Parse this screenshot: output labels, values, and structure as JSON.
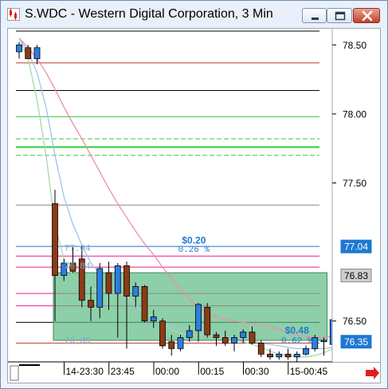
{
  "window": {
    "title": "S.WDC - Western Digital Corporation, 3 Min",
    "icon": "chart-app-icon",
    "buttons": [
      "minimize-icon",
      "maximize-icon",
      "close-icon"
    ]
  },
  "chart_data": {
    "type": "candlestick",
    "symbol": "S.WDC",
    "interval": "3 Min",
    "y_range": [
      76.25,
      78.6
    ],
    "y_ticks": [
      "78.50",
      "78.00",
      "77.50",
      "77.04",
      "76.83",
      "76.50",
      "76.35"
    ],
    "y_tick_values": [
      78.5,
      78.0,
      77.5,
      77.04,
      76.83,
      76.5,
      76.35
    ],
    "price_badges": [
      {
        "label": "77.04",
        "value": 77.04,
        "color": "#1e78d2"
      },
      {
        "label": "76.83",
        "value": 76.83,
        "color": "#cfcfcf"
      },
      {
        "label": "76.35",
        "value": 76.35,
        "color": "#1e78d2"
      }
    ],
    "x_ticks": [
      "14-23:30",
      "23:45",
      "00:00",
      "00:15",
      "00:30",
      "15-00:45"
    ],
    "x_tick_bar_index": [
      6,
      11,
      16,
      21,
      26,
      31
    ],
    "candles": [
      {
        "o": 78.45,
        "h": 78.52,
        "l": 78.4,
        "c": 78.5
      },
      {
        "o": 78.48,
        "h": 78.5,
        "l": 78.4,
        "c": 78.4
      },
      {
        "o": 78.4,
        "h": 78.5,
        "l": 78.36,
        "c": 78.48
      },
      null,
      {
        "o": 77.35,
        "h": 77.45,
        "l": 76.5,
        "c": 76.83
      },
      {
        "o": 76.83,
        "h": 76.95,
        "l": 76.79,
        "c": 76.92
      },
      {
        "o": 76.92,
        "h": 77.04,
        "l": 76.85,
        "c": 76.86
      },
      {
        "o": 76.95,
        "h": 77.04,
        "l": 76.6,
        "c": 76.65
      },
      {
        "o": 76.65,
        "h": 76.75,
        "l": 76.5,
        "c": 76.6
      },
      {
        "o": 76.6,
        "h": 76.92,
        "l": 76.52,
        "c": 76.88
      },
      {
        "o": 76.85,
        "h": 76.93,
        "l": 76.58,
        "c": 76.7
      },
      {
        "o": 76.7,
        "h": 76.92,
        "l": 76.38,
        "c": 76.9
      },
      {
        "o": 76.9,
        "h": 76.93,
        "l": 76.3,
        "c": 76.68
      },
      {
        "o": 76.68,
        "h": 76.78,
        "l": 76.6,
        "c": 76.75
      },
      {
        "o": 76.75,
        "h": 76.76,
        "l": 76.49,
        "c": 76.5
      },
      {
        "o": 76.5,
        "h": 76.58,
        "l": 76.45,
        "c": 76.53
      },
      {
        "o": 76.5,
        "h": 76.52,
        "l": 76.3,
        "c": 76.32
      },
      {
        "o": 76.35,
        "h": 76.4,
        "l": 76.25,
        "c": 76.3
      },
      {
        "o": 76.3,
        "h": 76.4,
        "l": 76.28,
        "c": 76.38
      },
      {
        "o": 76.38,
        "h": 76.47,
        "l": 76.35,
        "c": 76.43
      },
      {
        "o": 76.43,
        "h": 76.63,
        "l": 76.35,
        "c": 76.62
      },
      {
        "o": 76.6,
        "h": 76.63,
        "l": 76.38,
        "c": 76.4
      },
      {
        "o": 76.4,
        "h": 76.42,
        "l": 76.32,
        "c": 76.38
      },
      {
        "o": 76.38,
        "h": 76.43,
        "l": 76.32,
        "c": 76.34
      },
      {
        "o": 76.34,
        "h": 76.4,
        "l": 76.28,
        "c": 76.38
      },
      {
        "o": 76.38,
        "h": 76.44,
        "l": 76.34,
        "c": 76.42
      },
      {
        "o": 76.42,
        "h": 76.46,
        "l": 76.33,
        "c": 76.34
      },
      {
        "o": 76.34,
        "h": 76.36,
        "l": 76.24,
        "c": 76.26
      },
      {
        "o": 76.26,
        "h": 76.3,
        "l": 76.22,
        "c": 76.24
      },
      {
        "o": 76.24,
        "h": 76.28,
        "l": 76.22,
        "c": 76.26
      },
      {
        "o": 76.26,
        "h": 76.3,
        "l": 76.22,
        "c": 76.24
      },
      {
        "o": 76.24,
        "h": 76.28,
        "l": 76.2,
        "c": 76.26
      },
      {
        "o": 76.26,
        "h": 76.32,
        "l": 76.25,
        "c": 76.3
      },
      {
        "o": 76.3,
        "h": 76.4,
        "l": 76.28,
        "c": 76.38
      },
      {
        "o": 76.35,
        "h": 76.38,
        "l": 76.25,
        "c": 76.36
      },
      {
        "o": 76.33,
        "h": 76.53,
        "l": 76.3,
        "c": 76.51
      },
      {
        "o": 76.5,
        "h": 76.56,
        "l": 76.48,
        "c": 76.51
      }
    ],
    "horizontal_levels": [
      {
        "value": 78.6,
        "color": "#000000",
        "style": "solid",
        "width": 1
      },
      {
        "value": 78.37,
        "color": "#c0392b",
        "style": "solid",
        "width": 1
      },
      {
        "value": 78.17,
        "color": "#000000",
        "style": "solid",
        "width": 1
      },
      {
        "value": 77.98,
        "color": "#2ecc40",
        "style": "solid",
        "width": 1
      },
      {
        "value": 77.82,
        "color": "#2ecc40",
        "style": "dashed",
        "width": 1
      },
      {
        "value": 77.76,
        "color": "#2ecc40",
        "style": "solid",
        "width": 2
      },
      {
        "value": 77.7,
        "color": "#2ecc40",
        "style": "dashed",
        "width": 1
      },
      {
        "value": 77.34,
        "color": "#888888",
        "style": "solid",
        "width": 1
      },
      {
        "value": 77.04,
        "color": "#1e78d2",
        "style": "solid",
        "width": 1
      },
      {
        "value": 76.97,
        "color": "#e91e8c",
        "style": "solid",
        "width": 1
      },
      {
        "value": 76.89,
        "color": "#e91e8c",
        "style": "solid",
        "width": 1
      },
      {
        "value": 76.7,
        "color": "#e91e8c",
        "style": "solid",
        "width": 1
      },
      {
        "value": 76.61,
        "color": "#e91e8c",
        "style": "solid",
        "width": 1
      },
      {
        "value": 76.49,
        "color": "#000000",
        "style": "solid",
        "width": 1
      },
      {
        "value": 76.34,
        "color": "#c0392b",
        "style": "solid",
        "width": 1
      }
    ],
    "range_box": {
      "from_index": 4,
      "to_index": 34,
      "high": 76.85,
      "low": 76.36,
      "color": "#5dbb83"
    },
    "annotations": [
      {
        "text": "$0.20",
        "value": 77.06,
        "bar": 19.5,
        "color": "#1e78d2",
        "bold": true
      },
      {
        "text": "0.26 %",
        "value": 77.0,
        "bar": 19.5,
        "color": "#1e78d2",
        "bold": false
      },
      {
        "text": "77.04",
        "value": 77.01,
        "bar": 6.5,
        "color": "#7fa6cf",
        "bold": false
      },
      {
        "text": "76.84",
        "value": 76.88,
        "bar": 6.5,
        "color": "#7fa6cf",
        "bold": false
      },
      {
        "text": "76.35",
        "value": 76.34,
        "bar": 6.5,
        "color": "#7fa6cf",
        "bold": false
      },
      {
        "text": "$0.48",
        "value": 76.41,
        "bar": 31.0,
        "color": "#1e78d2",
        "bold": true
      },
      {
        "text": "0.62 %",
        "value": 76.34,
        "bar": 31.0,
        "color": "#1e78d2",
        "bold": false
      }
    ],
    "series": [
      {
        "style": "pink-average",
        "color": "#f08cae",
        "values": [
          78.55,
          78.48,
          78.4,
          78.3,
          78.18,
          78.05,
          77.93,
          77.82,
          77.7,
          77.58,
          77.46,
          77.35,
          77.25,
          77.15,
          77.06,
          76.98,
          76.89,
          76.81,
          76.73,
          76.66,
          76.6,
          76.56,
          76.53,
          76.51,
          76.5,
          76.49,
          76.48,
          76.47,
          76.46,
          76.44,
          76.42,
          76.4,
          76.39,
          76.38,
          76.38,
          76.39,
          76.4
        ]
      },
      {
        "style": "blue-average",
        "color": "#9ec5e8",
        "values": [
          78.55,
          78.45,
          78.3,
          78.05,
          77.7,
          77.4,
          77.2,
          77.05,
          76.92,
          76.84,
          76.78,
          76.72,
          76.66,
          76.6,
          76.55,
          76.52,
          76.49,
          76.46,
          76.44,
          76.43,
          76.42,
          76.41,
          76.4,
          76.39,
          76.38,
          76.37,
          76.36,
          76.34,
          76.33,
          76.32,
          76.31,
          76.3,
          76.3,
          76.3,
          76.3,
          76.31,
          76.33
        ]
      },
      {
        "style": "green-average",
        "color": "#a8d8a8",
        "values": [
          78.55,
          78.4,
          78.1,
          77.7,
          77.2,
          76.95,
          76.83,
          76.78,
          76.74,
          76.72,
          76.71,
          76.7,
          76.68,
          76.62,
          76.56,
          76.52,
          76.48,
          76.44,
          76.41,
          76.4,
          76.4,
          76.4,
          76.39,
          76.37,
          76.36,
          76.35,
          76.33,
          76.31,
          76.28,
          76.26,
          76.25,
          76.24,
          76.24,
          76.25,
          76.27,
          76.3,
          76.32
        ]
      }
    ]
  },
  "timescale": {
    "arrow_icon": "scroll-right-arrow-icon"
  }
}
